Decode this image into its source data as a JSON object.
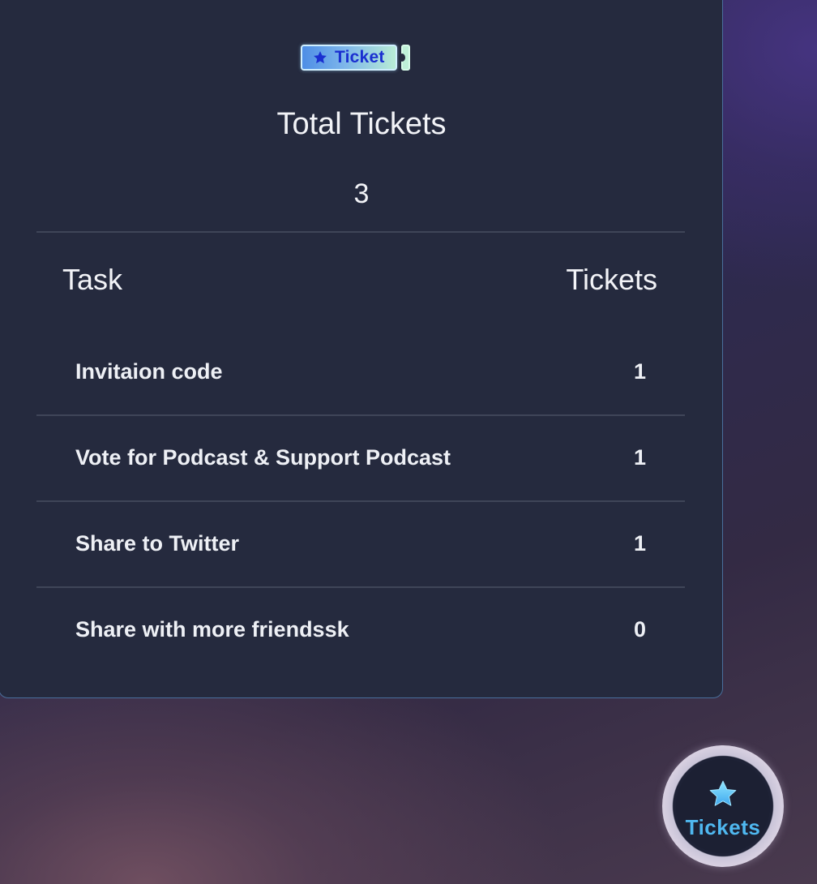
{
  "badge": {
    "label": "Ticket",
    "icon": "star-icon"
  },
  "summary": {
    "title": "Total Tickets",
    "value": "3"
  },
  "table": {
    "headers": {
      "task": "Task",
      "tickets": "Tickets"
    },
    "rows": [
      {
        "task": "Invitaion code",
        "tickets": "1"
      },
      {
        "task": "Vote for Podcast & Support Podcast",
        "tickets": "1"
      },
      {
        "task": "Share to Twitter",
        "tickets": "1"
      },
      {
        "task": "Share with more friendssk",
        "tickets": "0"
      }
    ]
  },
  "fab": {
    "label": "Tickets",
    "icon": "star-icon"
  },
  "colors": {
    "panel_bg": "#252a3e",
    "panel_border": "#4a6f9c",
    "badge_text": "#1a2fd0",
    "fab_label": "#4fb8f0"
  }
}
